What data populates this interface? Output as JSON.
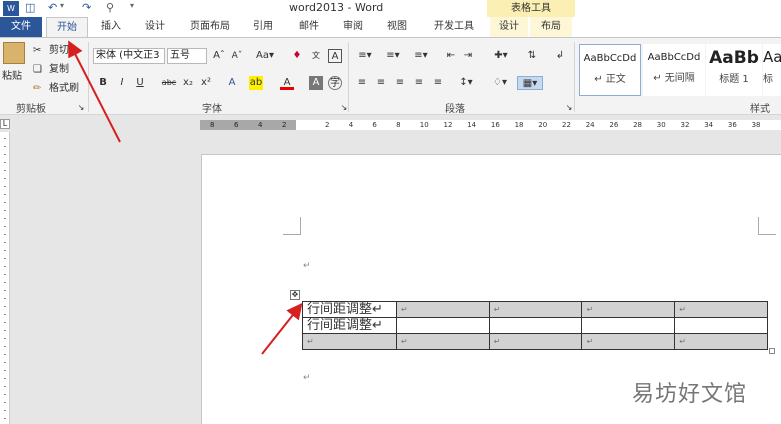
{
  "title_bar": {
    "doc_title": "word2013 - Word",
    "context_tools": "表格工具",
    "qa_icons": [
      "word-logo-icon",
      "save-icon",
      "undo-icon",
      "redo-icon",
      "print-preview-icon",
      "customize-qa-icon"
    ]
  },
  "tabs": [
    {
      "label": "文件",
      "kind": "file"
    },
    {
      "label": "开始",
      "kind": "active"
    },
    {
      "label": "插入",
      "kind": "normal"
    },
    {
      "label": "设计",
      "kind": "normal"
    },
    {
      "label": "页面布局",
      "kind": "normal"
    },
    {
      "label": "引用",
      "kind": "normal"
    },
    {
      "label": "邮件",
      "kind": "normal"
    },
    {
      "label": "审阅",
      "kind": "normal"
    },
    {
      "label": "视图",
      "kind": "normal"
    },
    {
      "label": "开发工具",
      "kind": "normal"
    },
    {
      "label": "设计",
      "kind": "ctx"
    },
    {
      "label": "布局",
      "kind": "ctx"
    }
  ],
  "clipboard": {
    "paste": "粘贴",
    "cut": "剪切",
    "copy": "复制",
    "format_painter": "格式刷",
    "group": "剪贴板"
  },
  "font": {
    "font_name": "宋体 (中文正3",
    "font_size": "五号",
    "group": "字体"
  },
  "paragraph": {
    "group": "段落"
  },
  "styles": {
    "group": "样式",
    "items": [
      {
        "sample": "AaBbCcDd",
        "name": "↵ 正文"
      },
      {
        "sample": "AaBbCcDd",
        "name": "↵ 无间隔"
      },
      {
        "sample": "AaBb",
        "name": "标题 1"
      },
      {
        "sample": "Aa",
        "name": "标"
      }
    ]
  },
  "ruler": {
    "tab_selector": "L",
    "left_numbers": [
      "8",
      "6",
      "4",
      "2"
    ],
    "right_numbers": [
      "2",
      "4",
      "6",
      "8",
      "10",
      "12",
      "14",
      "16",
      "18",
      "20",
      "22",
      "24",
      "26",
      "28",
      "30",
      "32",
      "34",
      "36",
      "38"
    ]
  },
  "document": {
    "paragraph_mark": "↵",
    "move_handle": "✥",
    "rows": [
      [
        "行间距调整↵",
        "↵",
        "↵",
        "↵",
        "↵"
      ],
      [
        "行间距调整↵",
        "",
        "",
        "",
        ""
      ],
      [
        "↵",
        "↵",
        "↵",
        "↵",
        "↵"
      ]
    ]
  },
  "watermark": "易坊好文馆",
  "colors": {
    "accent": "#2b579a",
    "arrow": "#d62020",
    "context_tab": "#fbefb3"
  }
}
